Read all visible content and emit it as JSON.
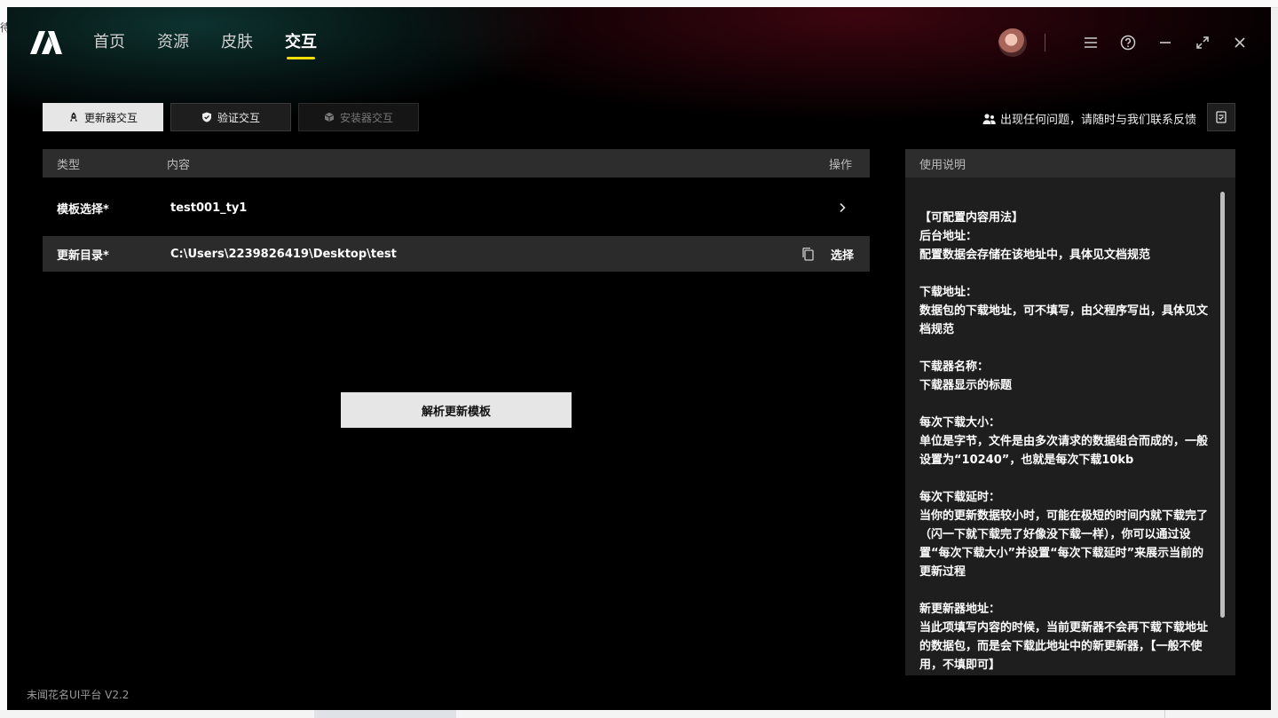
{
  "background": {
    "left_glyph": "待"
  },
  "nav": {
    "items": [
      {
        "label": "首页",
        "active": false
      },
      {
        "label": "资源",
        "active": false
      },
      {
        "label": "皮肤",
        "active": false
      },
      {
        "label": "交互",
        "active": true
      }
    ]
  },
  "colors": {
    "accent": "#f2df00",
    "panel": "#2d2d2d",
    "button": "#e6e6e6"
  },
  "subtabs": [
    {
      "label": "更新器交互",
      "icon": "rocket-icon",
      "state": "active"
    },
    {
      "label": "验证交互",
      "icon": "shield-check-icon",
      "state": "normal"
    },
    {
      "label": "安装器交互",
      "icon": "box-icon",
      "state": "disabled"
    }
  ],
  "feedback": {
    "text": "出现任何问题，请随时与我们联系反馈"
  },
  "table": {
    "headers": {
      "type": "类型",
      "content": "内容",
      "action": "操作"
    },
    "rows": [
      {
        "type": "模板选择*",
        "value": "test001_ty1"
      },
      {
        "type": "更新目录*",
        "value": "C:\\Users\\2239826419\\Desktop\\test",
        "action": "选择"
      }
    ]
  },
  "parse_button": "解析更新模板",
  "help": {
    "title": "使用说明",
    "lines": [
      "【可配置内容用法】",
      "后台地址：",
      "配置数据会存储在该地址中，具体见文档规范",
      "",
      "下载地址：",
      "数据包的下载地址，可不填写，由父程序写出，具体见文档规范",
      "",
      "下载器名称：",
      "下载器显示的标题",
      "",
      "每次下载大小：",
      "单位是字节，文件是由多次请求的数据组合而成的，一般设置为“10240”，也就是每次下载10kb",
      "",
      "每次下载延时：",
      "当你的更新数据较小时，可能在极短的时间内就下载完了（闪一下就下载完了好像没下载一样），你可以通过设置“每次下载大小”并设置“每次下载延时”来展示当前的更新过程",
      "",
      "新更新器地址：",
      "当此项填写内容的时候，当前更新器不会再下载下载地址的数据包，而是会下载此地址中的新更新器，【一般不使用，不填即可】"
    ]
  },
  "version": "未闻花名UI平台 V2.2"
}
